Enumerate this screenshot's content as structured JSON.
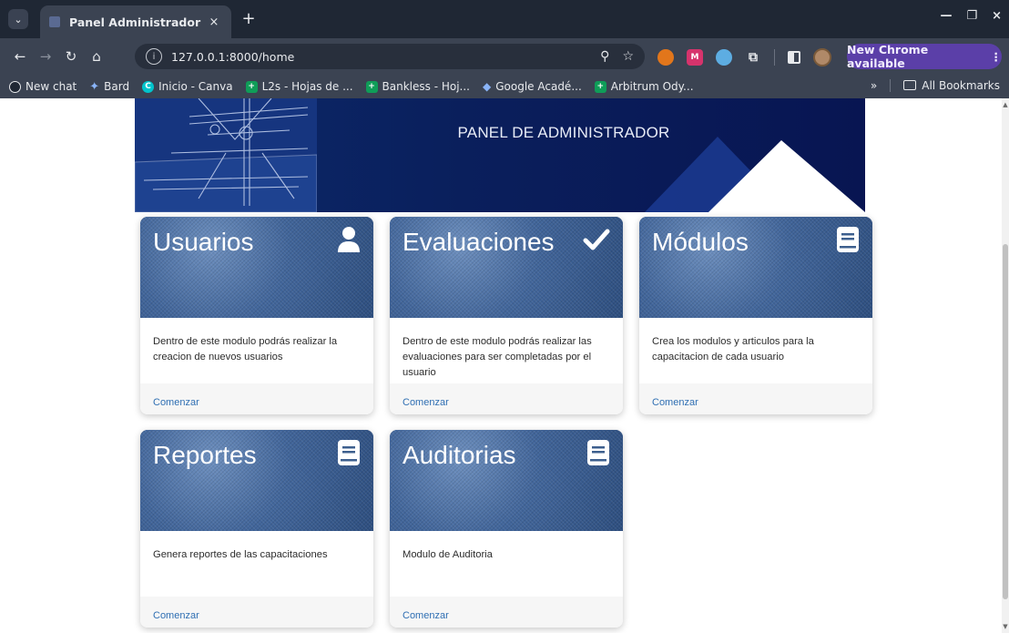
{
  "browser": {
    "tab_title": "Panel Administrador",
    "tab_close": "×",
    "new_tab": "+",
    "tab_menu": "⌄",
    "url": "127.0.0.1:8000/home",
    "update_label": "New Chrome available",
    "update_menu": "⋮",
    "window_controls": {
      "minimize": "—",
      "restore": "❐",
      "close": "×"
    }
  },
  "bookmarks": {
    "items": [
      {
        "label": "New chat",
        "icon": "chat-icon"
      },
      {
        "label": "Bard",
        "icon": "bard-icon"
      },
      {
        "label": "Inicio - Canva",
        "icon": "canva-icon",
        "glyph": "C"
      },
      {
        "label": "L2s - Hojas de ...",
        "icon": "sheets-icon",
        "glyph": "+"
      },
      {
        "label": "Bankless - Hoj...",
        "icon": "sheets-icon",
        "glyph": "+"
      },
      {
        "label": "Google Acadé...",
        "icon": "scholar-icon"
      },
      {
        "label": "Arbitrum Ody...",
        "icon": "sheets-icon",
        "glyph": "+"
      }
    ],
    "overflow": "»",
    "all_bookmarks": "All Bookmarks"
  },
  "banner": {
    "title": "PANEL DE ADMINISTRADOR"
  },
  "cards": [
    {
      "title": "Usuarios",
      "icon": "user-icon",
      "description": "Dentro de este modulo podrás realizar la creacion de nuevos usuarios",
      "link": "Comenzar"
    },
    {
      "title": "Evaluaciones",
      "icon": "check-icon",
      "description": "Dentro de este modulo podrás realizar las evaluaciones para ser completadas por el usuario",
      "link": "Comenzar"
    },
    {
      "title": "Módulos",
      "icon": "book-icon",
      "description": "Crea los modulos y articulos para la capacitacion de cada usuario",
      "link": "Comenzar"
    },
    {
      "title": "Reportes",
      "icon": "book-icon",
      "description": "Genera reportes de las capacitaciones",
      "link": "Comenzar"
    },
    {
      "title": "Auditorias",
      "icon": "book-icon",
      "description": "Modulo de Auditoria",
      "link": "Comenzar"
    }
  ],
  "colors": {
    "banner": "#0a1f5c",
    "link": "#2f6fb3",
    "chrome_update": "#5b3fa8"
  }
}
